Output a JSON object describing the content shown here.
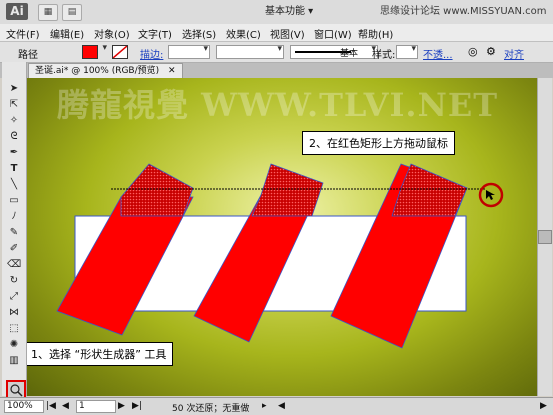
{
  "app": {
    "logo": "Ai",
    "workspace": "基本功能 ▾",
    "watermark_top": "思缘设计论坛 www.MISSYUAN.com"
  },
  "menu": [
    "文件(F)",
    "编辑(E)",
    "对象(O)",
    "文字(T)",
    "选择(S)",
    "效果(C)",
    "视图(V)",
    "窗口(W)",
    "帮助(H)"
  ],
  "control_bar": {
    "selection_label": "路径",
    "stroke_label": "描边:",
    "style_label": "基本",
    "opacity_label": "样式:",
    "opacity_link": "不透...",
    "align_label": "对齐"
  },
  "document": {
    "tab": "圣诞.ai* @ 100% (RGB/预览)"
  },
  "canvas": {
    "watermark": "腾龍視覺 WWW.TLVI.NET",
    "callout_top": "2、在红色矩形上方拖动鼠标",
    "callout_bottom": "1、选择 “形状生成器” 工具"
  },
  "status": {
    "zoom": "100%",
    "page": "1",
    "info": "50 次还原；无重做"
  },
  "colors": {
    "fill": "#ff0000",
    "stripe": "#ff0000",
    "highlight": "#e00000"
  }
}
